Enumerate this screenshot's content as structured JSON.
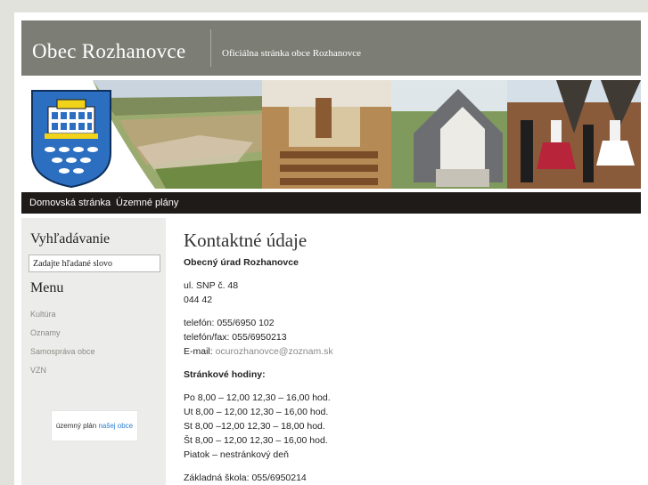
{
  "header": {
    "title": "Obec Rozhanovce",
    "subtitle": "Oficiálna stránka obce Rozhanovce"
  },
  "nav": {
    "items": [
      "Domovská stránka",
      "Územné plány"
    ]
  },
  "sidebar": {
    "search_heading": "Vyhľadávanie",
    "search_value": "Zadajte hľadané slovo",
    "menu_heading": "Menu",
    "menu_items": [
      "Kultúra",
      "Oznamy",
      "Samospráva obce",
      "VZN"
    ],
    "promo": {
      "text_part1": "územný plán",
      "text_part2": "našej obce"
    }
  },
  "content": {
    "title": "Kontaktné údaje",
    "office_name": "Obecný úrad Rozhanovce",
    "address_street": "ul. SNP č. 48",
    "address_zip": "044 42",
    "phone": "telefón:  055/6950 102",
    "phone_fax": "telefón/fax: 055/6950213",
    "email_label": "E-mail: ",
    "email": "ocurozhanovce@zoznam.sk",
    "hours_heading": "Stránkové hodiny:",
    "hours": [
      "Po 8,00 – 12,00  12,30 – 16,00 hod.",
      "Ut  8,00 – 12,00  12,30 – 16,00 hod.",
      "St   8,00 –12,00   12,30 – 18,00 hod.",
      "Št   8,00 – 12,00  12,30 – 16,00 hod.",
      "Piatok – nestránkový deň"
    ],
    "school": "Základná škola: 055/6950214"
  },
  "colors": {
    "header_bg": "#7c7e75",
    "nav_bg": "#1e1b18",
    "sidebar_bg": "#ececea",
    "link_accent": "#2a7fd0"
  }
}
